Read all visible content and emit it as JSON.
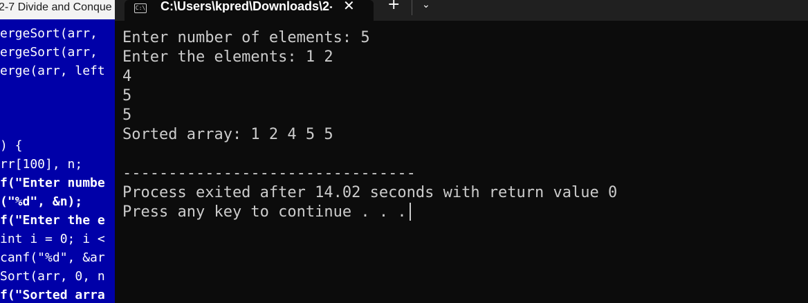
{
  "ide": {
    "title": "2-7 Divide and Conque",
    "code_lines": [
      {
        "text": "ergeSort(arr, ",
        "bold": false
      },
      {
        "text": "ergeSort(arr, ",
        "bold": false
      },
      {
        "text": "erge(arr, left",
        "bold": false
      },
      {
        "text": "",
        "bold": false
      },
      {
        "text": "",
        "bold": false
      },
      {
        "text": "",
        "bold": false
      },
      {
        "text": ") {",
        "bold": false
      },
      {
        "text": "rr[100], n;",
        "bold": false
      },
      {
        "text": "f(\"Enter numbe",
        "bold": true
      },
      {
        "text": "(\"%d\", &n);",
        "bold": true
      },
      {
        "text": "f(\"Enter the e",
        "bold": true
      },
      {
        "text": "int i = 0; i <",
        "bold": false
      },
      {
        "text": "canf(\"%d\", &ar",
        "bold": false
      },
      {
        "text": "Sort(arr, 0, n",
        "bold": false
      },
      {
        "text": "f(\"Sorted arra",
        "bold": true
      }
    ]
  },
  "terminal": {
    "icon_label": "C:\\",
    "tab_title": "C:\\Users\\kpred\\Downloads\\2-",
    "close_symbol": "✕",
    "new_tab_symbol": "+",
    "dropdown_symbol": "⌄",
    "output_lines": [
      "Enter number of elements: 5",
      "Enter the elements: 1 2",
      "4",
      "5",
      "5",
      "Sorted array: 1 2 4 5 5",
      "",
      "--------------------------------",
      "Process exited after 14.02 seconds with return value 0",
      "Press any key to continue . . ."
    ]
  }
}
